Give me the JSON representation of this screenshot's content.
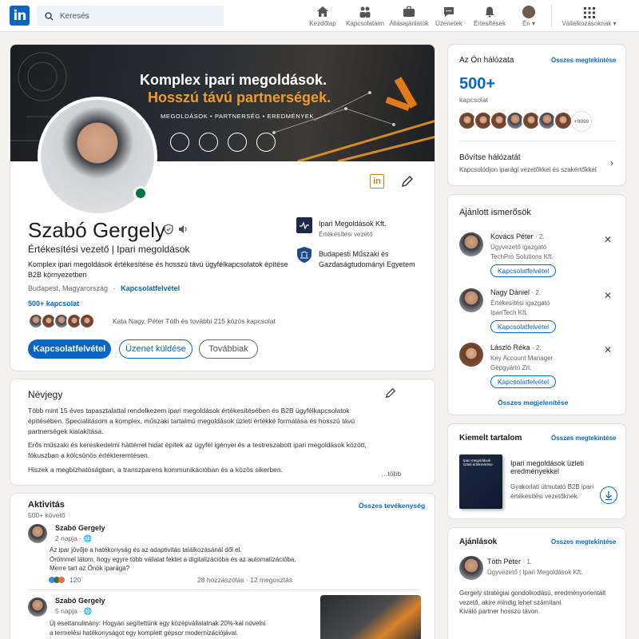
{
  "nav": {
    "search_placeholder": "Keresés",
    "items": [
      {
        "label": "Kezdőlap",
        "icon": "home-icon"
      },
      {
        "label": "Kapcsolataim",
        "icon": "network-icon"
      },
      {
        "label": "Állásajánlatok",
        "icon": "briefcase-icon"
      },
      {
        "label": "Üzenetek",
        "icon": "messages-icon"
      },
      {
        "label": "Értesítések",
        "icon": "bell-icon"
      },
      {
        "label": "Én",
        "icon": "avatar"
      },
      {
        "label": "Vállalkozásoknak",
        "icon": "grid-icon"
      }
    ]
  },
  "banner": {
    "title": "Komplex ipari megoldások.",
    "subtitle": "Hosszú távú partnerségek.",
    "tagline": "MEGOLDÁSOK  •  PARTNERSÉG  •  EREDMÉNYEK"
  },
  "profile": {
    "name": "Szabó Gergely",
    "headline": "Értékesítési vezető | Ipari megoldások",
    "about_line1": "Komplex ipari megoldások értékesítése és hosszú távú ügyfélkapcsolatok építése",
    "about_line2": "B2B környezetben",
    "location": "Budapest, Magyarország",
    "contact_link": "Kapcsolatfelvétel",
    "connections": "500+ kapcsolat",
    "mutual": "Kata Nagy, Péter Tóth és további 215 közös kapcsolat",
    "btn_connect": "Kapcsolatfelvétel",
    "btn_message": "Üzenet küldése",
    "btn_more": "Továbbiak",
    "company": "Ipari Megoldások Kft.",
    "company_role": "Értékesítési vezető",
    "school_line1": "Budapesti Műszaki és",
    "school_line2": "Gazdaságtudományi Egyetem"
  },
  "about": {
    "title": "Névjegy",
    "p1_l1": "Több mint 15 éves tapasztalattal rendelkezem ipari megoldások értékesítésében és B2B ügyfélkapcsolatok",
    "p1_l2": "építésében. Specialitásom a komplex, műszaki tartalmú megoldások üzleti értékké formálása és hosszú távú",
    "p1_l3": "partnerségek kialakítása.",
    "p2_l1": "Erős műszaki és kereskedelmi háttérrel hidat építek az ügyfél igényei és a testreszabott ipari megoldások között,",
    "p2_l2": "fókuszban a kölcsönös értékteremtésen.",
    "p3": "Hiszek a megbízhatóságban, a transzparens kommunikációban és a közös sikerben.",
    "more": "…több"
  },
  "activity": {
    "title": "Aktivitás",
    "followers": "500+ követő",
    "all_link": "Összes tevékenység",
    "post1": {
      "author": "Szabó Gergely",
      "time": "2 napja",
      "l1": "Az ipar jövője a hatékonyság és az adaptivitás találkozásánál dől el.",
      "l2": "Örömmel látom, hogy egyre több vállalat fektet a digitalizációba és az automatizációba.",
      "l3": "Merre tart az Önök iparága?",
      "reactions": "120",
      "comments": "28 hozzászólás",
      "shares": "12 megosztás"
    },
    "post2": {
      "author": "Szabó Gergely",
      "time": "5 napja",
      "l1": "Új esettanulmány: Hogyan segítettünk egy középvállalatnak 20%-kal növelni",
      "l2": "a termelési hatékonyságot egy komplett gépsor modernizációjával."
    }
  },
  "network": {
    "title": "Az Ön hálózata",
    "all_link": "Összes megtekintése",
    "count": "500+",
    "count_label": "kapcsolat",
    "extra": "+9999",
    "expand_title": "Bővítse hálózatát",
    "expand_sub": "Kapcsolódjon iparági vezetőkkel és szakértőkkel"
  },
  "suggestions": {
    "title": "Ajánlott ismerősök",
    "items": [
      {
        "name": "Kovács Péter",
        "degree": "· 2.",
        "role": "Ügyvezető igazgató",
        "company": "TechPro Solutions Kft.",
        "button": "Kapcsolatfelvétel"
      },
      {
        "name": "Nagy Dániel",
        "degree": "· 2.",
        "role": "Értékesítési igazgató",
        "company": "IpariTech Kft.",
        "button": "Kapcsolatfelvétel"
      },
      {
        "name": "László Réka",
        "degree": "· 2.",
        "role": "Key Account Manager",
        "company": "Gépgyártó Zrt.",
        "button": "Kapcsolatfelvétel"
      }
    ],
    "show_all": "Összes megjelenítése"
  },
  "featured": {
    "title": "Kiemelt tartalom",
    "all_link": "Összes megtekintése",
    "book_title": "Ipari megoldások üzleti értékmérése",
    "item_title_l1": "Ipari megoldások üzleti",
    "item_title_l2": "eredményekkel",
    "item_desc_l1": "Gyakorlati útmutató B2B ipari",
    "item_desc_l2": "értékesítési vezetőknek."
  },
  "recommendations": {
    "title": "Ajánlások",
    "all_link": "Összes megtekintése",
    "name": "Tóth Péter",
    "degree": "· 1.",
    "role": "Ügyvezető | Ipari Megoldások Kft.",
    "q1": "Gergely stratégiai gondolkodású, eredményorientált",
    "q2": "vezető, akire mindig lehet számítani.",
    "q3": "Kiváló partner hosszú távon."
  }
}
